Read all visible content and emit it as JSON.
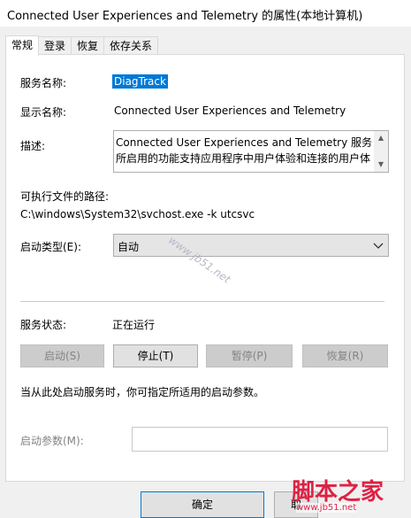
{
  "window": {
    "title": "Connected User Experiences and Telemetry 的属性(本地计算机)"
  },
  "tabs": [
    {
      "label": "常规",
      "active": true
    },
    {
      "label": "登录",
      "active": false
    },
    {
      "label": "恢复",
      "active": false
    },
    {
      "label": "依存关系",
      "active": false
    }
  ],
  "general": {
    "service_name_label": "服务名称:",
    "service_name_value": "DiagTrack",
    "display_name_label": "显示名称:",
    "display_name_value": "Connected User Experiences and Telemetry",
    "description_label": "描述:",
    "description_value": "Connected User Experiences and Telemetry 服务所启用的功能支持应用程序中用户体验和连接的用户体",
    "path_label": "可执行文件的路径:",
    "path_value": "C:\\windows\\System32\\svchost.exe -k utcsvc",
    "startup_type_label": "启动类型(E):",
    "startup_type_value": "自动",
    "status_label": "服务状态:",
    "status_value": "正在运行",
    "buttons": {
      "start": "启动(S)",
      "stop": "停止(T)",
      "pause": "暂停(P)",
      "resume": "恢复(R)"
    },
    "hint": "当从此处启动服务时，你可指定所适用的启动参数。",
    "params_label": "启动参数(M):",
    "params_value": ""
  },
  "footer": {
    "ok": "确定",
    "cancel": "取"
  },
  "watermark": {
    "diagonal_url": "www.jb51.net",
    "logo_text": "脚本之家",
    "logo_url": "www.jb51.net"
  },
  "colors": {
    "selection": "#0078d7",
    "watermark": "#d22244"
  }
}
